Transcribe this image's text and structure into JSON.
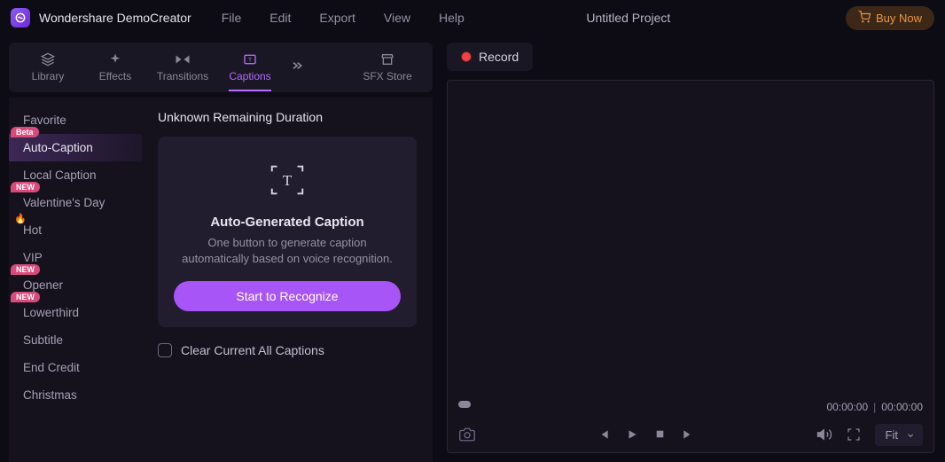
{
  "app": {
    "title": "Wondershare DemoCreator"
  },
  "menu": {
    "file": "File",
    "edit": "Edit",
    "export": "Export",
    "view": "View",
    "help": "Help"
  },
  "project": {
    "title": "Untitled Project"
  },
  "buy": {
    "label": "Buy Now"
  },
  "tabs": {
    "library": "Library",
    "effects": "Effects",
    "transitions": "Transitions",
    "captions": "Captions",
    "sfx": "SFX Store"
  },
  "categories": {
    "favorite": "Favorite",
    "auto_caption": "Auto-Caption",
    "local_caption": "Local Caption",
    "valentines": "Valentine's Day",
    "hot": "Hot",
    "vip": "VIP",
    "opener": "Opener",
    "lowerthird": "Lowerthird",
    "subtitle": "Subtitle",
    "end_credit": "End Credit",
    "christmas": "Christmas"
  },
  "badges": {
    "beta": "Beta",
    "new": "NEW"
  },
  "panel": {
    "header": "Unknown Remaining Duration",
    "card_title": "Auto-Generated Caption",
    "card_desc": "One button to generate caption automatically based on voice recognition.",
    "recognize": "Start to Recognize",
    "clear": "Clear Current All Captions"
  },
  "record": {
    "label": "Record"
  },
  "time": {
    "current": "00:00:00",
    "total": "00:00:00"
  },
  "fit": {
    "label": "Fit"
  }
}
